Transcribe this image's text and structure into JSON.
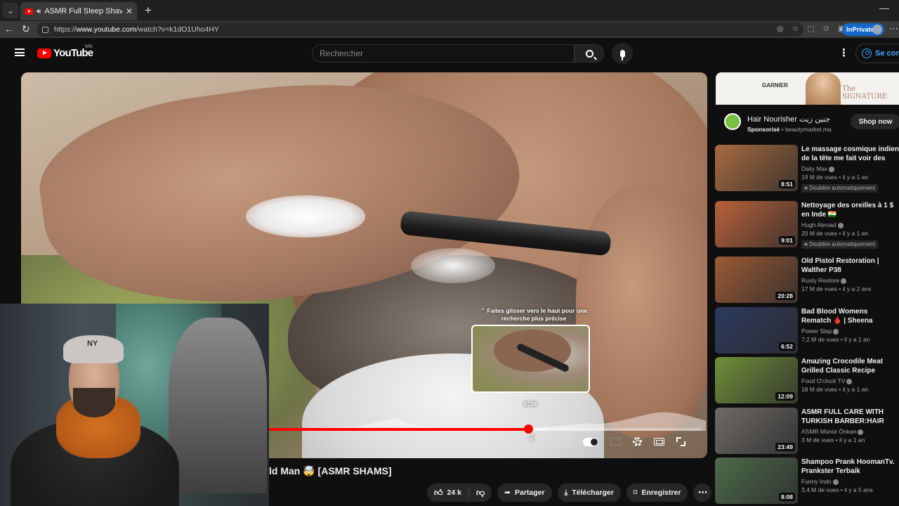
{
  "browser": {
    "tab_title": "ASMR Full Sleep Shaving & H",
    "url_prefix": "https://",
    "url_domain": "www.youtube.com",
    "url_path": "/watch?v=k1dO1Uho4HY",
    "inprivate_label": "InPrivate"
  },
  "header": {
    "logo_text": "YouTube",
    "country_code": "MA",
    "search_placeholder": "Rechercher",
    "signin_label": "Se connecter"
  },
  "player": {
    "seek_hint": "⌃ Faites glisser vers le haut pour une recherche plus précise",
    "preview_time": "8:36",
    "progress_played": 0.6,
    "progress_buffered": 0.645,
    "autoplay_on": true
  },
  "video": {
    "title": "ld Man 🤯 [ASMR SHAMS]",
    "likes": "24 k",
    "share_label": "Partager",
    "download_label": "Télécharger",
    "save_label": "Enregistrer"
  },
  "ad": {
    "brand": "GARNIER",
    "banner_text": "The SIGNATURE",
    "title": "Hair Nourisher جنين زيت",
    "sponsored": "Sponsorisé",
    "domain": "beautymarket.ma",
    "cta": "Shop now"
  },
  "recommendations": [
    {
      "title": "Le massage cosmique indien de la tête me fait voir des étoiles ...",
      "channel": "Daily Max",
      "stats": "19 M de vues • il y a 1 an",
      "duration": "8:51",
      "badge": "Doublée automatiquement",
      "thumb_color": "#a86b3f"
    },
    {
      "title": "Nettoyage des oreilles à 1 $ en Inde 🇮🇳",
      "channel": "Hugh Abroad",
      "stats": "20 M de vues • il y a 1 an",
      "duration": "9:01",
      "badge": "Doublée automatiquement",
      "thumb_color": "#b8623a"
    },
    {
      "title": "Old Pistol Restoration | Walther P38",
      "channel": "Rusty Restore",
      "stats": "17 M de vues • il y a 2 ans",
      "duration": "20:28",
      "badge": "",
      "thumb_color": "#9a5a35"
    },
    {
      "title": "Bad Blood Womens Rematch 🩸 | Sheena Bathory vs Jackie...",
      "channel": "Power Slap",
      "stats": "7,2 M de vues • il y a 1 an",
      "duration": "6:52",
      "badge": "",
      "thumb_color": "#2d3a5e"
    },
    {
      "title": "Amazing Crocodile Meat Grilled Classic Recipe Ingredients ...",
      "channel": "Food O'clock TV",
      "stats": "18 M de vues • il y a 1 an",
      "duration": "12:09",
      "badge": "",
      "thumb_color": "#6f8f3a"
    },
    {
      "title": "ASMR FULL CARE WITH TURKISH BARBER:HAIR AND ...",
      "channel": "ASMR Münür Önkan",
      "stats": "3 M de vues • il y a 1 an",
      "duration": "23:49",
      "badge": "",
      "thumb_color": "#6e6a66"
    },
    {
      "title": "Shampoo Prank HoomanTv. Prankster Terbaik",
      "channel": "Funny Indo",
      "stats": "3,4 M de vues • il y a 5 ans",
      "duration": "8:08",
      "badge": "",
      "thumb_color": "#4d6a4a"
    }
  ]
}
